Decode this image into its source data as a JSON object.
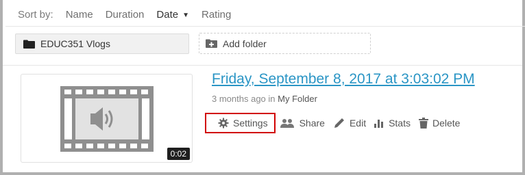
{
  "sort_bar": {
    "label": "Sort by:",
    "options": [
      {
        "label": "Name"
      },
      {
        "label": "Duration"
      },
      {
        "label": "Date",
        "active": true
      },
      {
        "label": "Rating"
      }
    ]
  },
  "folder": {
    "name": "EDUC351 Vlogs",
    "icon": "folder-icon"
  },
  "add_folder": {
    "label": "Add folder",
    "icon": "add-folder-icon"
  },
  "video": {
    "title": "Friday, September 8, 2017 at 3:03:02 PM",
    "meta_prefix": "3 months ago in ",
    "meta_folder": "My Folder",
    "duration": "0:02",
    "thumbnail_icon": "audio-film-icon"
  },
  "actions": {
    "settings": "Settings",
    "share": "Share",
    "edit": "Edit",
    "stats": "Stats",
    "delete": "Delete"
  },
  "colors": {
    "title_link": "#2a95c5",
    "highlight_border": "#d10000",
    "frame": "#b0b0b0"
  }
}
